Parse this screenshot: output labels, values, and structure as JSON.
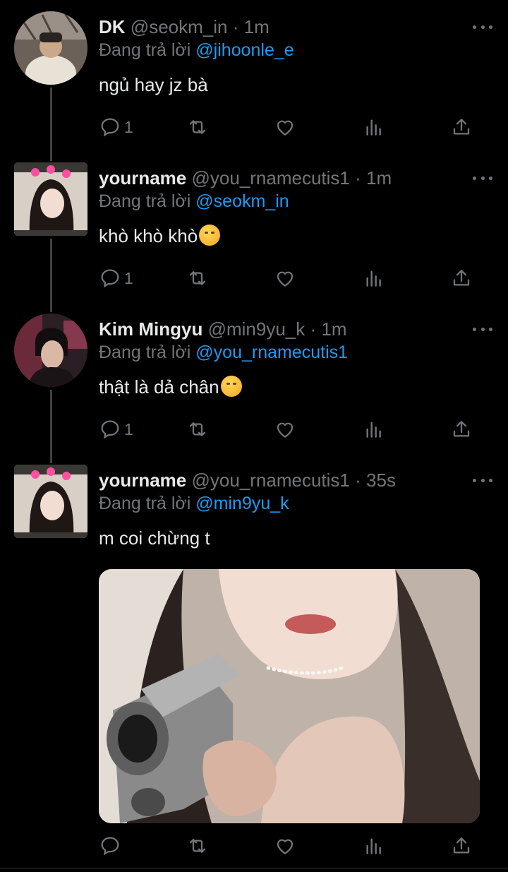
{
  "colors": {
    "background": "#000000",
    "text_primary": "#e7e9ea",
    "text_secondary": "#71767b",
    "accent": "#1d9bf0",
    "thread_line": "#3e4144"
  },
  "tweets": [
    {
      "display_name": "DK",
      "handle": "@seokm_in",
      "time": "1m",
      "reply_prefix": "Đang trả lời",
      "reply_to": "@jihoonle_e",
      "text": "ngủ hay jz bà",
      "emoji": "",
      "reply_count": "1",
      "avatar_icon": "avatar-photo"
    },
    {
      "display_name": "yourname",
      "handle": "@you_rnamecutis1",
      "time": "1m",
      "reply_prefix": "Đang trả lời",
      "reply_to": "@seokm_in",
      "text": "khò khò khò",
      "emoji": "drooling-face-emoji",
      "reply_count": "1",
      "avatar_icon": "avatar-photo"
    },
    {
      "display_name": "Kim Mingyu",
      "handle": "@min9yu_k",
      "time": "1m",
      "reply_prefix": "Đang trả lời",
      "reply_to": "@you_rnamecutis1",
      "text": "thật là dả chân",
      "emoji": "smiling-face-emoji",
      "reply_count": "1",
      "avatar_icon": "avatar-photo"
    },
    {
      "display_name": "yourname",
      "handle": "@you_rnamecutis1",
      "time": "35s",
      "reply_prefix": "Đang trả lời",
      "reply_to": "@min9yu_k",
      "text": "m coi chừng t",
      "emoji": "",
      "reply_count": "",
      "avatar_icon": "avatar-photo",
      "media_icon": "photo-girl-holding-gun"
    }
  ],
  "action_icons": [
    "reply-icon",
    "retweet-icon",
    "like-icon",
    "views-icon",
    "share-icon"
  ],
  "separator": "·"
}
